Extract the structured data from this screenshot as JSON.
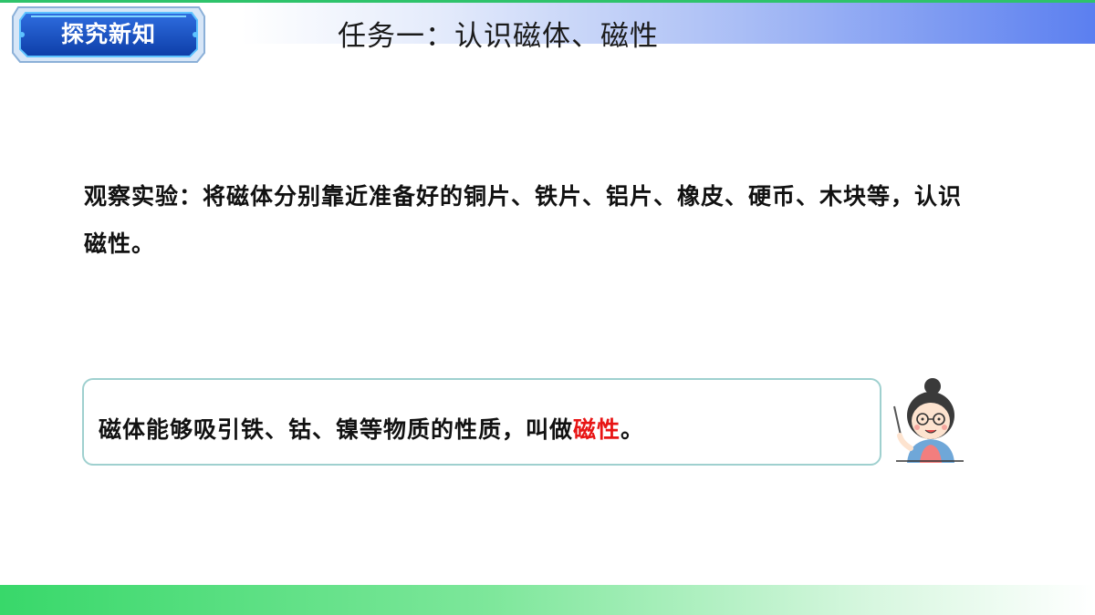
{
  "header": {
    "badge_label": "探究新知",
    "title": "任务一：认识磁体、磁性"
  },
  "observation": {
    "label": "观察实验：",
    "text": "将磁体分别靠近准备好的铜片、铁片、铝片、橡皮、硬币、木块等，认识磁性。"
  },
  "definition": {
    "text_before": "磁体能够吸引铁、钴、镍等物质的性质，叫做",
    "highlight": "磁性",
    "text_after": "。"
  },
  "colors": {
    "accent_green": "#38d86a",
    "accent_blue": "#5b7ff0",
    "highlight_red": "#e81414",
    "box_border": "#9fd0cf"
  },
  "icons": {
    "teacher": "teacher-with-pointer-icon"
  }
}
